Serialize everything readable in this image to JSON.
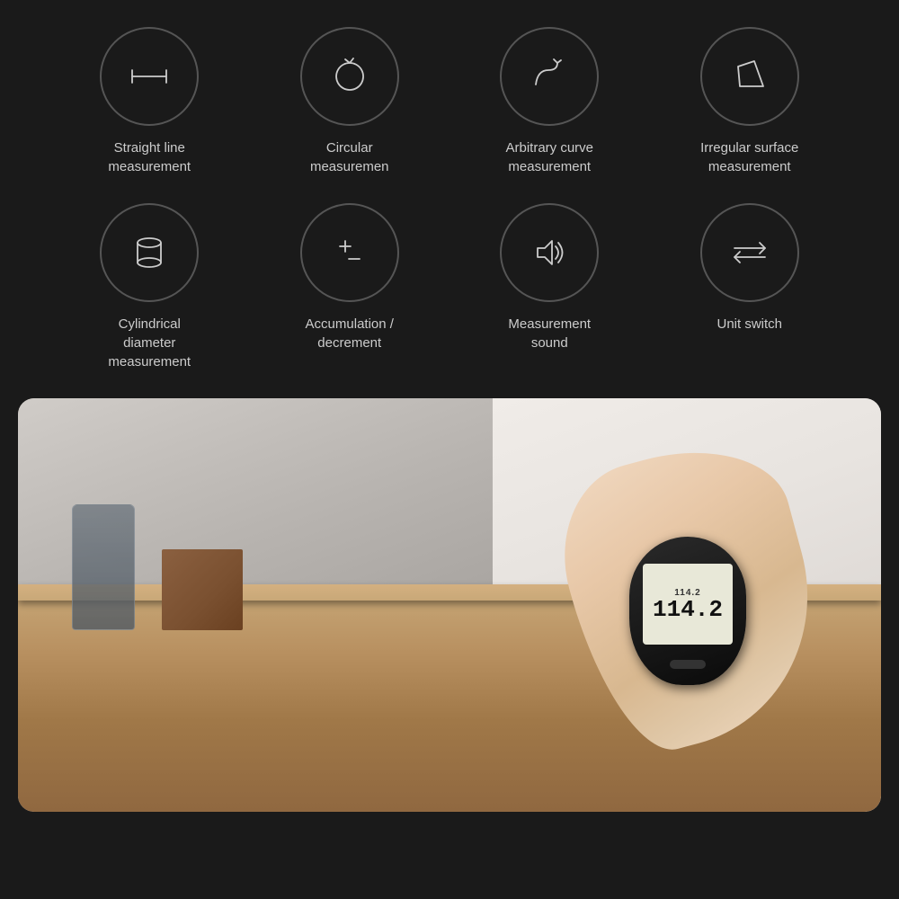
{
  "bg_color": "#1a1a1a",
  "features": [
    {
      "id": "straight-line",
      "label": "Straight line\nmeasurement",
      "icon": "straight-line-icon"
    },
    {
      "id": "circular",
      "label": "Circular\nmeasuremen",
      "icon": "circular-icon"
    },
    {
      "id": "arbitrary-curve",
      "label": "Arbitrary curve\nmeasurement",
      "icon": "arbitrary-curve-icon"
    },
    {
      "id": "irregular-surface",
      "label": "Irregular surface\nmeasurement",
      "icon": "irregular-surface-icon"
    },
    {
      "id": "cylindrical",
      "label": "Cylindrical\ndiameter\nmeasurement",
      "icon": "cylinder-icon"
    },
    {
      "id": "accumulation",
      "label": "Accumulation /\ndecrement",
      "icon": "plus-minus-icon"
    },
    {
      "id": "measurement-sound",
      "label": "Measurement\nsound",
      "icon": "sound-icon"
    },
    {
      "id": "unit-switch",
      "label": "Unit switch",
      "icon": "switch-icon"
    }
  ],
  "device": {
    "reading_small": "114.2",
    "reading_large": "114.2"
  }
}
